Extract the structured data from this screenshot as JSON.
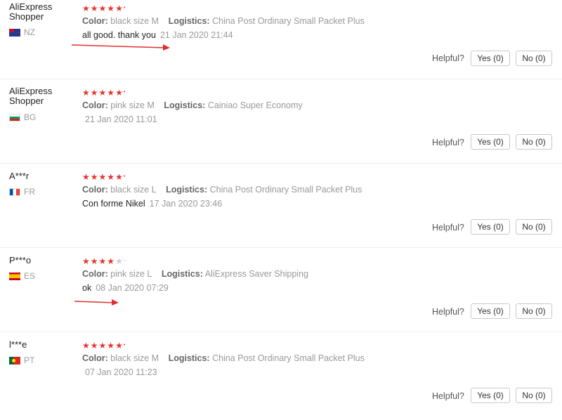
{
  "reviews": [
    {
      "user": "AliExpress Shopper",
      "country": "NZ",
      "flag": "nz",
      "rating": 5,
      "color_label": "Color:",
      "color_value": "black size M",
      "logistics_label": "Logistics:",
      "logistics_value": "China Post Ordinary Small Packet Plus",
      "text": "all good. thank you",
      "date": "21 Jan 2020 21:44",
      "helpful_label": "Helpful?",
      "yes_label": "Yes (0)",
      "no_label": "No (0)"
    },
    {
      "user": "AliExpress Shopper",
      "country": "BG",
      "flag": "bg",
      "rating": 5,
      "color_label": "Color:",
      "color_value": "pink size M",
      "logistics_label": "Logistics:",
      "logistics_value": "Cainiao Super Economy",
      "text": "",
      "date": "21 Jan 2020 11:01",
      "helpful_label": "Helpful?",
      "yes_label": "Yes (0)",
      "no_label": "No (0)"
    },
    {
      "user": "A***r",
      "country": "FR",
      "flag": "fr",
      "rating": 5,
      "color_label": "Color:",
      "color_value": "black size L",
      "logistics_label": "Logistics:",
      "logistics_value": "China Post Ordinary Small Packet Plus",
      "text": "Con forme Nikel",
      "date": "17 Jan 2020 23:46",
      "helpful_label": "Helpful?",
      "yes_label": "Yes (0)",
      "no_label": "No (0)"
    },
    {
      "user": "P***o",
      "country": "ES",
      "flag": "es",
      "rating": 4,
      "color_label": "Color:",
      "color_value": "pink size L",
      "logistics_label": "Logistics:",
      "logistics_value": "AliExpress Saver Shipping",
      "text": "ok",
      "date": "08 Jan 2020 07:29",
      "helpful_label": "Helpful?",
      "yes_label": "Yes (0)",
      "no_label": "No (0)"
    },
    {
      "user": "l***e",
      "country": "PT",
      "flag": "pt",
      "rating": 5,
      "color_label": "Color:",
      "color_value": "black size M",
      "logistics_label": "Logistics:",
      "logistics_value": "China Post Ordinary Small Packet Plus",
      "text": "",
      "date": "07 Jan 2020 11:23",
      "helpful_label": "Helpful?",
      "yes_label": "Yes (0)",
      "no_label": "No (0)"
    }
  ],
  "colors": {
    "star": "#e6342c",
    "arrow": "#e03030",
    "muted": "#999999"
  }
}
